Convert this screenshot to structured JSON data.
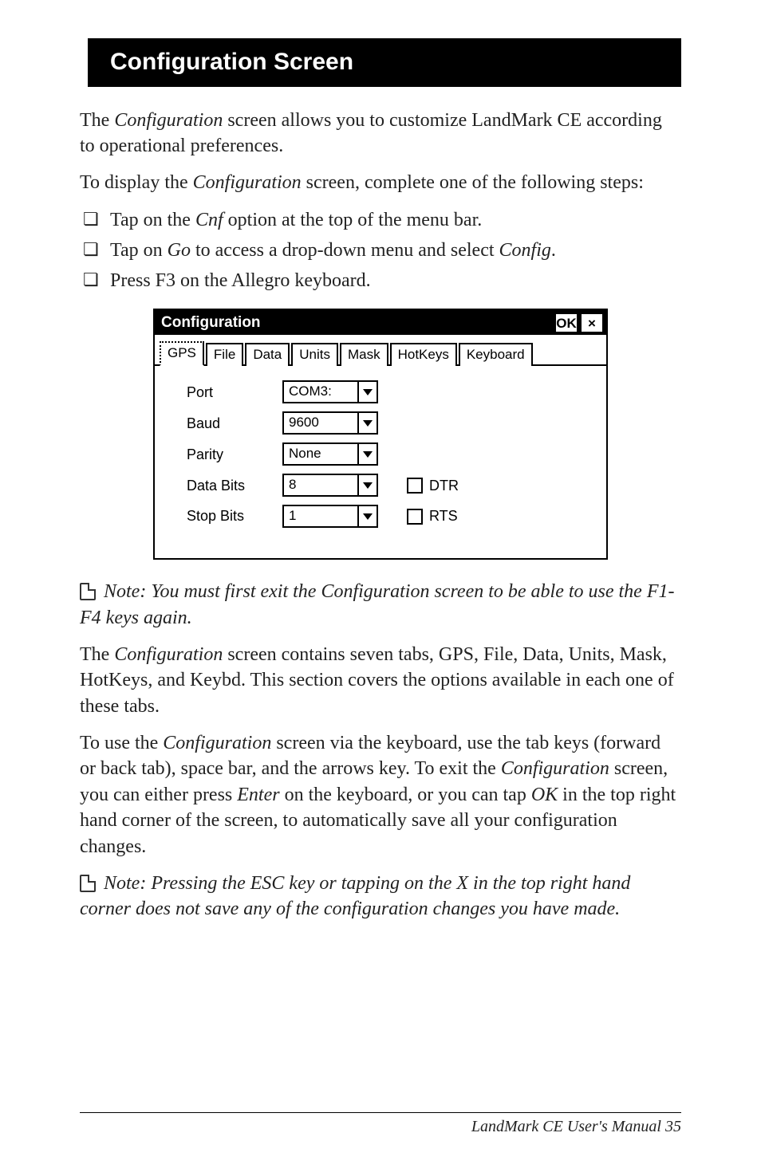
{
  "heading": "Configuration Screen",
  "p1a": "The ",
  "p1b": "Configuration",
  "p1c": " screen allows you to customize LandMark CE according to operational preferences.",
  "p2a": "To display the ",
  "p2b": "Configuration",
  "p2c": " screen, complete one of the following steps:",
  "bullets": {
    "b1a": "Tap on the ",
    "b1b": "Cnf",
    "b1c": " option at the top of the menu bar.",
    "b2a": "Tap on ",
    "b2b": "Go",
    "b2c": " to access a drop-down menu and select ",
    "b2d": "Config",
    "b2e": ".",
    "b3": "Press F3 on the Allegro keyboard."
  },
  "win": {
    "title": "Configuration",
    "ok": "OK",
    "close": "×",
    "tabs": {
      "gps": "GPS",
      "file": "File",
      "data": "Data",
      "units": "Units",
      "mask": "Mask",
      "hotkeys": "HotKeys",
      "keyboard": "Keyboard"
    },
    "labels": {
      "port": "Port",
      "baud": "Baud",
      "parity": "Parity",
      "databits": "Data Bits",
      "stopbits": "Stop Bits"
    },
    "values": {
      "port": "COM3:",
      "baud": "9600",
      "parity": "None",
      "databits": "8",
      "stopbits": "1"
    },
    "chk": {
      "dtr": "DTR",
      "rts": "RTS"
    }
  },
  "note1": " Note: You must first exit the Configuration screen to be able to use the F1-F4 keys again.",
  "p3a": "The ",
  "p3b": "Configuration",
  "p3c": " screen contains seven tabs, GPS, File, Data, Units, Mask, HotKeys, and Keybd. This section covers the options available in each one of these tabs.",
  "p4a": "To use the ",
  "p4b": "Configuration",
  "p4c": " screen via the keyboard, use the tab keys (forward or back tab), space bar, and the arrows key. To exit the ",
  "p4d": "Configuration",
  "p4e": " screen, you can either press ",
  "p4f": "Enter",
  "p4g": " on the keyboard, or you can tap ",
  "p4h": "OK",
  "p4i": " in the top right hand corner of the screen, to automatically save all your configuration changes.",
  "note2": " Note: Pressing the ESC key or tapping on the X in the top right hand corner does not save any of the configuration changes you have made.",
  "footer_text": "LandMark CE User's Manual  35"
}
